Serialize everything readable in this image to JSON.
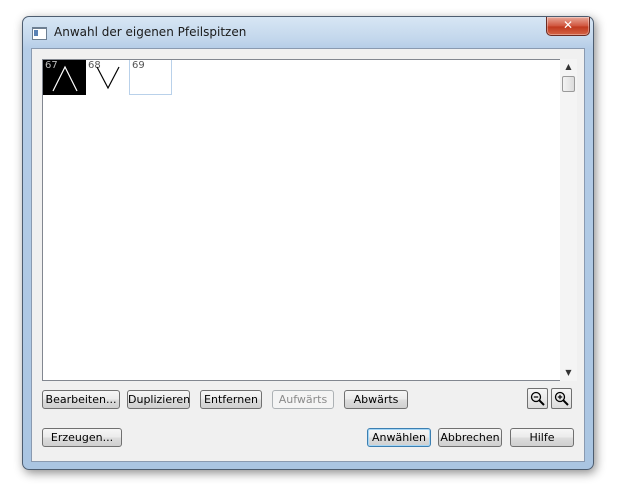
{
  "window": {
    "title": "Anwahl der eigenen Pfeilspitzen",
    "close_glyph": "✕"
  },
  "arrowheads": [
    {
      "number": "67",
      "selected": true,
      "icon": "arrowhead-up-icon"
    },
    {
      "number": "68",
      "selected": false,
      "icon": "arrowhead-down-icon"
    },
    {
      "number": "69",
      "selected": false,
      "icon": "empty"
    }
  ],
  "scrollbar": {
    "up_glyph": "▲",
    "down_glyph": "▼"
  },
  "toolbar": {
    "edit_label": "Bearbeiten...",
    "duplicate_label": "Duplizieren",
    "remove_label": "Entfernen",
    "up_label": "Aufwärts",
    "down_label": "Abwärts",
    "zoom_out_icon": "zoom-out-icon",
    "zoom_in_icon": "zoom-in-icon"
  },
  "footer": {
    "create_label": "Erzeugen...",
    "select_label": "Anwählen",
    "cancel_label": "Abbrechen",
    "help_label": "Hilfe"
  },
  "colors": {
    "selected_tile": "#000000",
    "default_button_border": "#3c7fb1",
    "close_button": "#c0391f"
  }
}
